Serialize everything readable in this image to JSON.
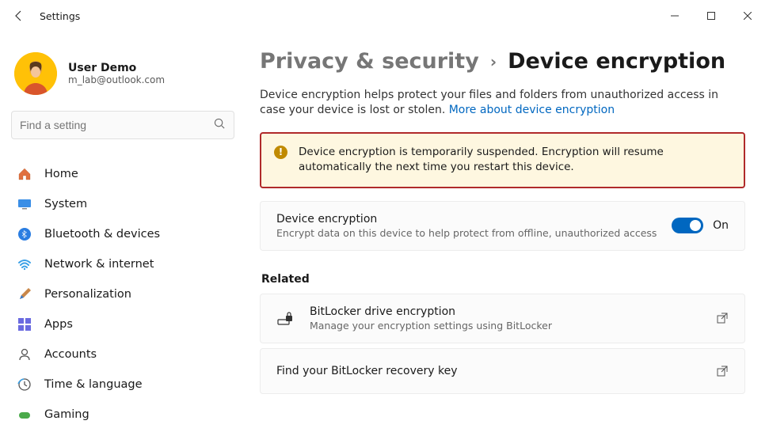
{
  "titlebar": {
    "title": "Settings"
  },
  "user": {
    "name": "User Demo",
    "email": "m_lab@outlook.com"
  },
  "search": {
    "placeholder": "Find a setting"
  },
  "nav": {
    "items": [
      {
        "label": "Home"
      },
      {
        "label": "System"
      },
      {
        "label": "Bluetooth & devices"
      },
      {
        "label": "Network & internet"
      },
      {
        "label": "Personalization"
      },
      {
        "label": "Apps"
      },
      {
        "label": "Accounts"
      },
      {
        "label": "Time & language"
      },
      {
        "label": "Gaming"
      }
    ]
  },
  "breadcrumb": {
    "parent": "Privacy & security",
    "current": "Device encryption"
  },
  "description": {
    "text": "Device encryption helps protect your files and folders from unauthorized access in case your device is lost or stolen. ",
    "link": "More about device encryption"
  },
  "warning": {
    "text": "Device encryption is temporarily suspended. Encryption will resume automatically the next time you restart this device."
  },
  "toggle_card": {
    "title": "Device encryption",
    "subtitle": "Encrypt data on this device to help protect from offline, unauthorized access",
    "state_label": "On"
  },
  "related": {
    "header": "Related",
    "cards": [
      {
        "title": "BitLocker drive encryption",
        "subtitle": "Manage your encryption settings using BitLocker"
      },
      {
        "title": "Find your BitLocker recovery key"
      }
    ]
  }
}
